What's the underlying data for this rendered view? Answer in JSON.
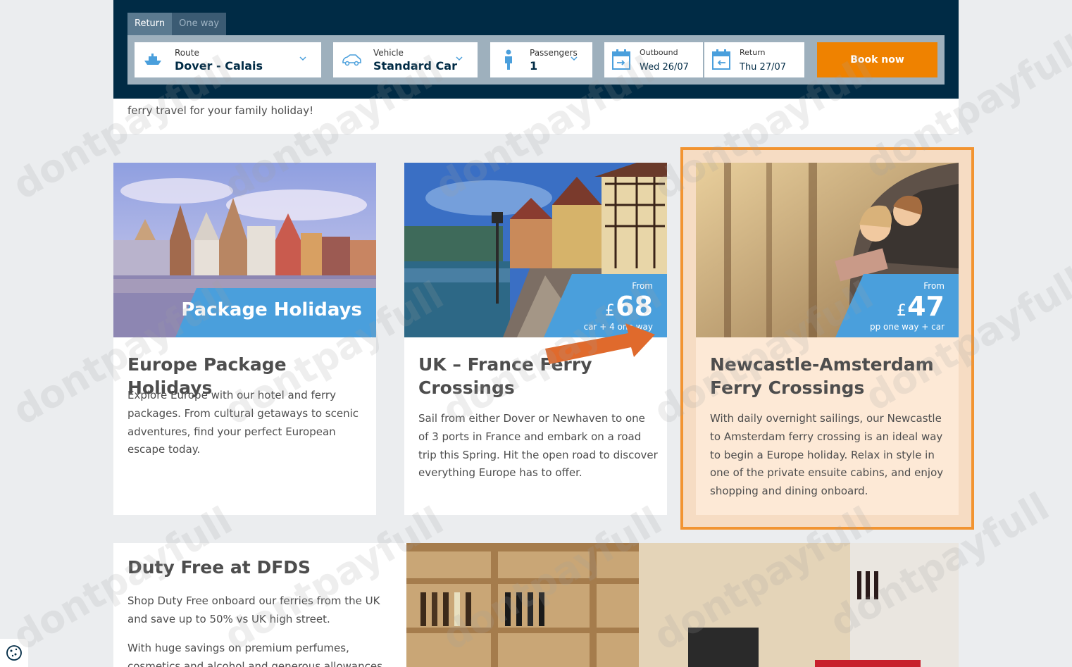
{
  "booking": {
    "tabs": [
      {
        "label": "Return"
      },
      {
        "label": "One way"
      }
    ],
    "route": {
      "label": "Route",
      "value": "Dover - Calais"
    },
    "vehicle": {
      "label": "Vehicle",
      "value": "Standard Car"
    },
    "passengers": {
      "label": "Passengers",
      "value": "1"
    },
    "outbound": {
      "label": "Outbound",
      "value": "Wed 26/07"
    },
    "return": {
      "label": "Return",
      "value": "Thu 27/07"
    },
    "book_label": "Book now"
  },
  "remnant": {
    "text": "ferry travel for your family holiday!"
  },
  "cards": [
    {
      "overlay": "Package Holidays",
      "title": "Europe Package Holidays",
      "desc": "Explore Europe with our hotel and ferry packages. From cultural getaways to scenic adventures, find your perfect European escape today."
    },
    {
      "from": "From",
      "currency": "£",
      "price": "68",
      "price_sub": "car + 4 one way",
      "title": "UK – France Ferry Crossings",
      "desc": "Sail from either Dover or Newhaven to one of 3 ports in France and embark on a road trip this Spring. Hit the open road to discover everything Europe has to offer."
    },
    {
      "from": "From",
      "currency": "£",
      "price": "47",
      "price_sub": "pp one way + car",
      "title": "Newcastle-Amsterdam Ferry Crossings",
      "desc": "With daily overnight sailings, our Newcastle to Amsterdam ferry crossing is an ideal way to begin a Europe holiday. Relax in style in one of the private ensuite cabins, and enjoy shopping and dining onboard."
    }
  ],
  "duty_free": {
    "title": "Duty Free at DFDS",
    "p1": "Shop Duty Free onboard our ferries from the UK and save up to 50% vs UK high street.",
    "p2": "With huge savings on premium perfumes, cosmetics and alcohol and generous allowances you can stock"
  },
  "watermark": "dontpayfull",
  "colors": {
    "navy": "#002b45",
    "orange": "#ef8200",
    "blue": "#4a9fdc",
    "highlight": "#f29431"
  }
}
